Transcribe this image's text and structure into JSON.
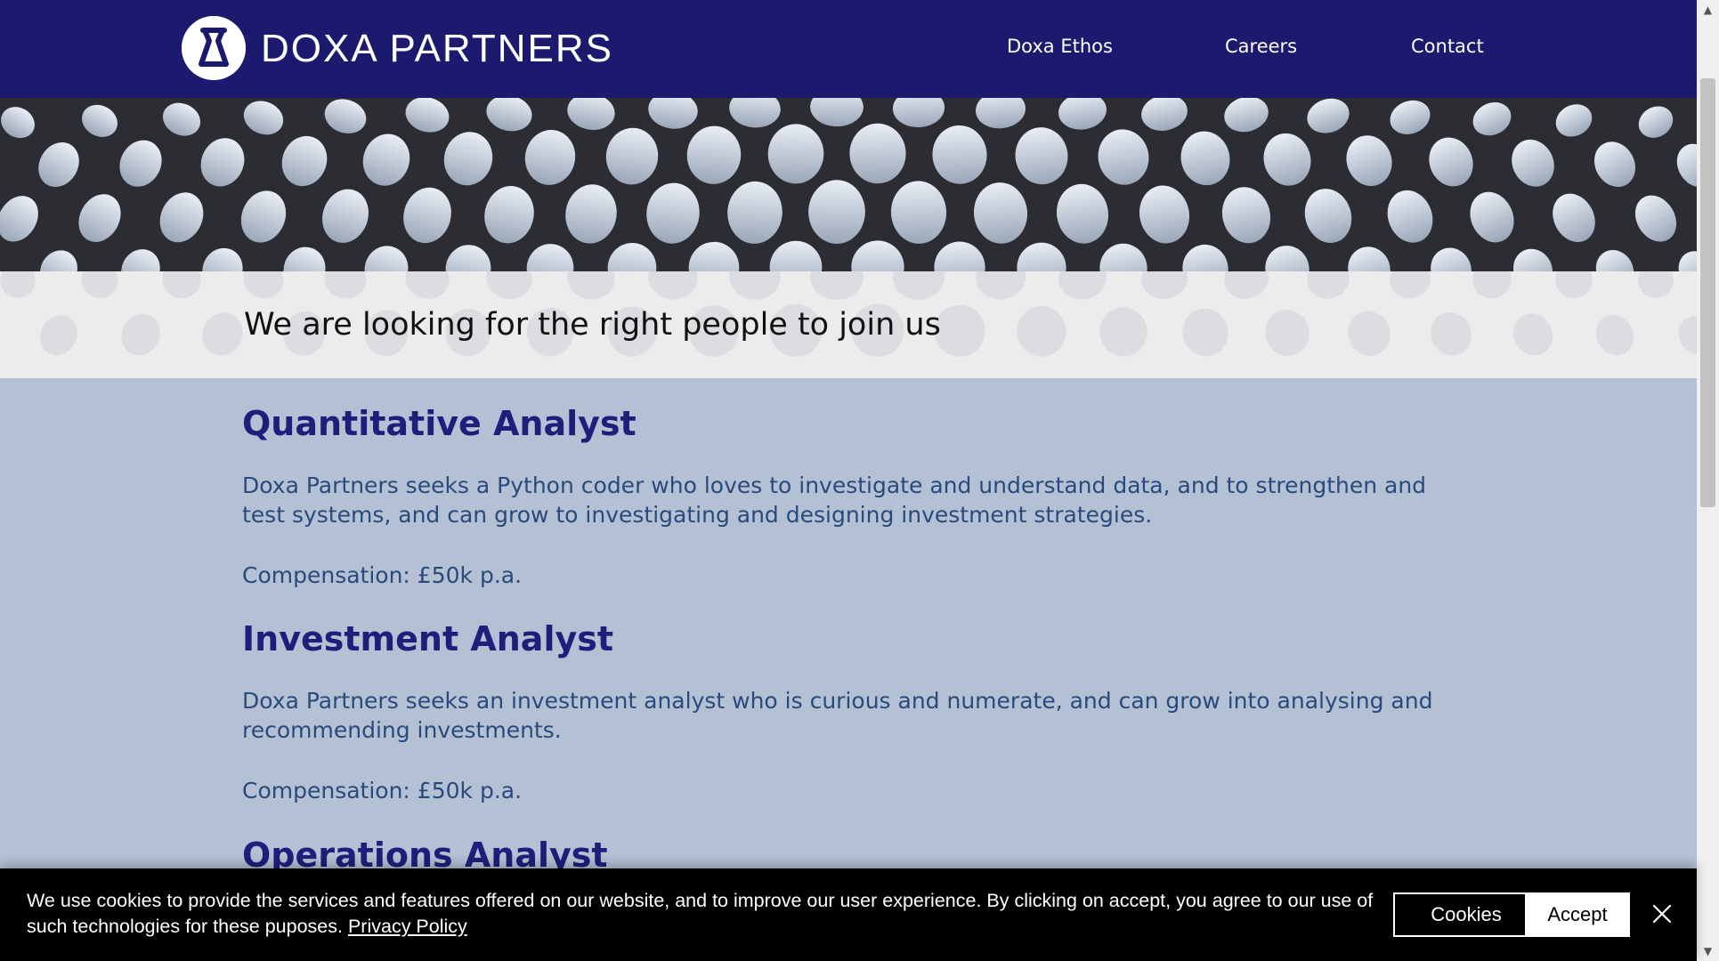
{
  "header": {
    "brand": "DOXA PARTNERS",
    "nav": {
      "ethos": "Doxa Ethos",
      "careers": "Careers",
      "contact": "Contact"
    },
    "bg_color": "#1c1a6e"
  },
  "intro": {
    "headline": "We are looking for the right people to join us"
  },
  "jobs": [
    {
      "title": "Quantitative Analyst",
      "description": "Doxa Partners seeks a Python coder who loves to investigate and understand data, and to strengthen and test systems, and can grow to investigating and designing investment strategies.",
      "compensation": "Compensation: £50k p.a."
    },
    {
      "title": "Investment Analyst",
      "description": "Doxa Partners seeks an investment analyst who is curious and numerate, and can grow into analysing and recommending investments.",
      "compensation": "Compensation: £50k p.a."
    },
    {
      "title": "Operations Analyst"
    }
  ],
  "cookie_banner": {
    "message": "We use cookies to provide the services and features offered on our website, and to improve our user experience. By clicking on accept, you agree to our use of such technologies for these puposes.",
    "privacy_link": "Privacy Policy",
    "cookies_button": "Cookies",
    "accept_button": "Accept",
    "close_icon": "close-icon"
  },
  "icons": {
    "logo": "doxa-logo-icon",
    "scroll_up": "scroll-up-arrow-icon",
    "scroll_down": "scroll-down-arrow-icon"
  },
  "colors": {
    "header_bg": "#1c1a6e",
    "content_bg": "#b4c0d4",
    "job_title": "#1f1e7a",
    "job_text": "#2a4a7c",
    "cookie_bg": "#000000"
  }
}
